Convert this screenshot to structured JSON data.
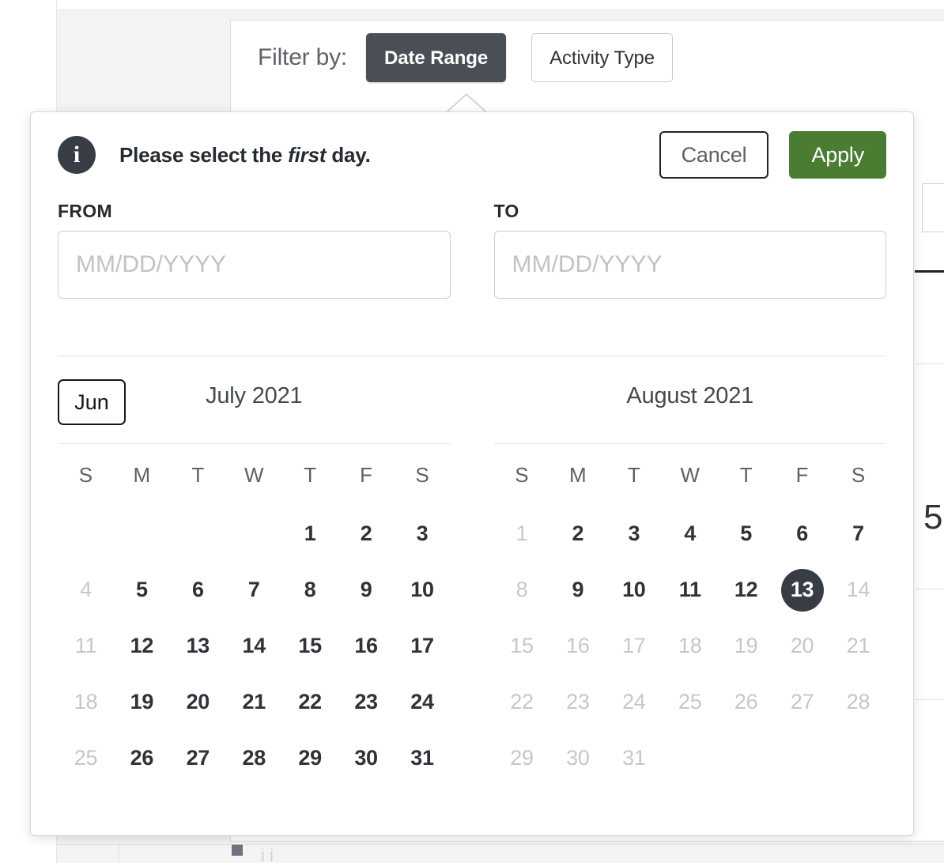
{
  "background": {
    "filter_label": "Filter by:",
    "chips": [
      {
        "label": "Date Range",
        "active": true
      },
      {
        "label": "Activity Type",
        "active": false
      }
    ],
    "peek_digit": "5",
    "bottom_text": "i i"
  },
  "popover": {
    "notice": {
      "icon": "info-icon",
      "badge_glyph": "i",
      "text_before": "Please select the ",
      "text_emphasis": "first",
      "text_after": " day."
    },
    "actions": {
      "cancel_label": "Cancel",
      "apply_label": "Apply"
    },
    "from_field": {
      "label": "FROM",
      "value": "",
      "placeholder": "MM/DD/YYYY"
    },
    "to_field": {
      "label": "TO",
      "value": "",
      "placeholder": "MM/DD/YYYY"
    },
    "prev_month_button": "Jun",
    "weekday_headers": [
      "S",
      "M",
      "T",
      "W",
      "T",
      "F",
      "S"
    ],
    "calendars": [
      {
        "title": "July 2021",
        "weeks": [
          [
            {
              "label": "",
              "state": "blank"
            },
            {
              "label": "",
              "state": "blank"
            },
            {
              "label": "",
              "state": "blank"
            },
            {
              "label": "",
              "state": "blank"
            },
            {
              "label": "1",
              "state": "enabled"
            },
            {
              "label": "2",
              "state": "enabled"
            },
            {
              "label": "3",
              "state": "enabled"
            }
          ],
          [
            {
              "label": "4",
              "state": "muted"
            },
            {
              "label": "5",
              "state": "enabled"
            },
            {
              "label": "6",
              "state": "enabled"
            },
            {
              "label": "7",
              "state": "enabled"
            },
            {
              "label": "8",
              "state": "enabled"
            },
            {
              "label": "9",
              "state": "enabled"
            },
            {
              "label": "10",
              "state": "enabled"
            }
          ],
          [
            {
              "label": "11",
              "state": "muted"
            },
            {
              "label": "12",
              "state": "enabled"
            },
            {
              "label": "13",
              "state": "enabled"
            },
            {
              "label": "14",
              "state": "enabled"
            },
            {
              "label": "15",
              "state": "enabled"
            },
            {
              "label": "16",
              "state": "enabled"
            },
            {
              "label": "17",
              "state": "enabled"
            }
          ],
          [
            {
              "label": "18",
              "state": "muted"
            },
            {
              "label": "19",
              "state": "enabled"
            },
            {
              "label": "20",
              "state": "enabled"
            },
            {
              "label": "21",
              "state": "enabled"
            },
            {
              "label": "22",
              "state": "enabled"
            },
            {
              "label": "23",
              "state": "enabled"
            },
            {
              "label": "24",
              "state": "enabled"
            }
          ],
          [
            {
              "label": "25",
              "state": "muted"
            },
            {
              "label": "26",
              "state": "enabled"
            },
            {
              "label": "27",
              "state": "enabled"
            },
            {
              "label": "28",
              "state": "enabled"
            },
            {
              "label": "29",
              "state": "enabled"
            },
            {
              "label": "30",
              "state": "enabled"
            },
            {
              "label": "31",
              "state": "enabled"
            }
          ]
        ]
      },
      {
        "title": "August 2021",
        "weeks": [
          [
            {
              "label": "1",
              "state": "muted"
            },
            {
              "label": "2",
              "state": "enabled"
            },
            {
              "label": "3",
              "state": "enabled"
            },
            {
              "label": "4",
              "state": "enabled"
            },
            {
              "label": "5",
              "state": "enabled"
            },
            {
              "label": "6",
              "state": "enabled"
            },
            {
              "label": "7",
              "state": "enabled"
            }
          ],
          [
            {
              "label": "8",
              "state": "muted"
            },
            {
              "label": "9",
              "state": "enabled"
            },
            {
              "label": "10",
              "state": "enabled"
            },
            {
              "label": "11",
              "state": "enabled"
            },
            {
              "label": "12",
              "state": "enabled"
            },
            {
              "label": "13",
              "state": "selected"
            },
            {
              "label": "14",
              "state": "muted"
            }
          ],
          [
            {
              "label": "15",
              "state": "muted"
            },
            {
              "label": "16",
              "state": "muted"
            },
            {
              "label": "17",
              "state": "muted"
            },
            {
              "label": "18",
              "state": "muted"
            },
            {
              "label": "19",
              "state": "muted"
            },
            {
              "label": "20",
              "state": "muted"
            },
            {
              "label": "21",
              "state": "muted"
            }
          ],
          [
            {
              "label": "22",
              "state": "muted"
            },
            {
              "label": "23",
              "state": "muted"
            },
            {
              "label": "24",
              "state": "muted"
            },
            {
              "label": "25",
              "state": "muted"
            },
            {
              "label": "26",
              "state": "muted"
            },
            {
              "label": "27",
              "state": "muted"
            },
            {
              "label": "28",
              "state": "muted"
            }
          ],
          [
            {
              "label": "29",
              "state": "muted"
            },
            {
              "label": "30",
              "state": "muted"
            },
            {
              "label": "31",
              "state": "muted"
            },
            {
              "label": "",
              "state": "blank"
            },
            {
              "label": "",
              "state": "blank"
            },
            {
              "label": "",
              "state": "blank"
            },
            {
              "label": "",
              "state": "blank"
            }
          ]
        ]
      }
    ]
  },
  "colors": {
    "accent_dark": "#4a4f57",
    "selected_day": "#383d45",
    "apply_green": "#4a7d32",
    "muted_text": "#c7c7c7",
    "body_text": "#2f3338"
  }
}
